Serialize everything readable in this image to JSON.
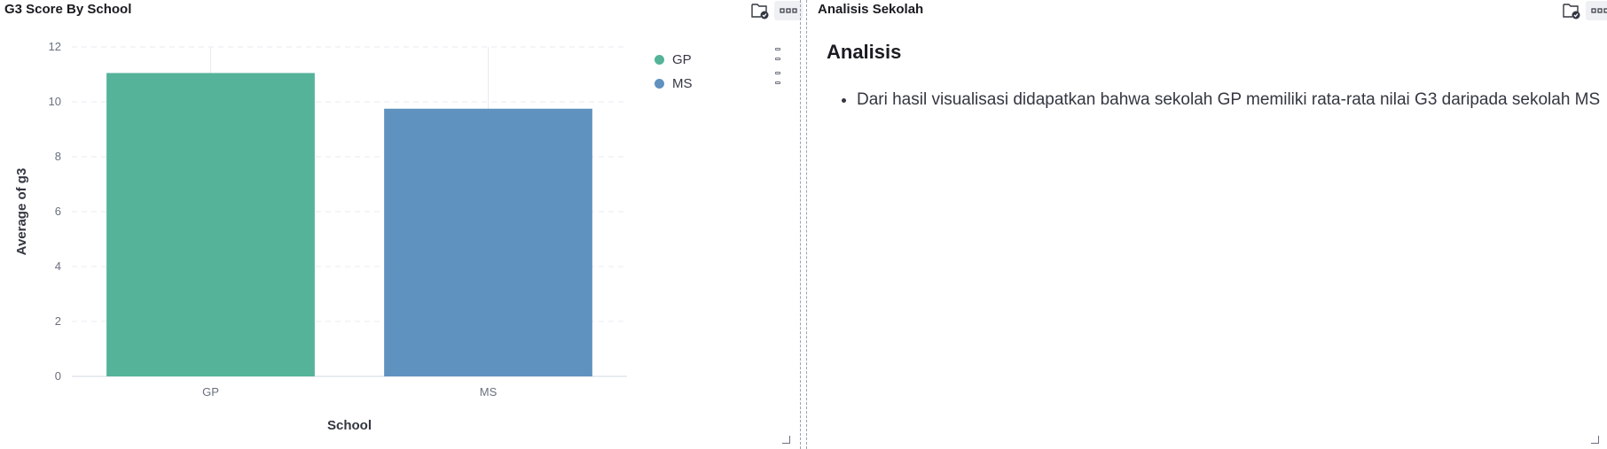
{
  "left_panel": {
    "title": "G3 Score By School",
    "icons": [
      "folder-check-icon",
      "options-icon"
    ]
  },
  "right_panel": {
    "title": "Analisis Sekolah",
    "icons": [
      "folder-check-icon",
      "options-icon"
    ],
    "markdown": {
      "heading": "Analisis",
      "bullets": [
        "Dari hasil visualisasi didapatkan bahwa sekolah GP memiliki rata-rata nilai G3 daripada sekolah MS"
      ]
    }
  },
  "colors": {
    "GP": "#54b399",
    "MS": "#6092c0",
    "grid": "#e9ebf0",
    "axis_text": "#69707d"
  },
  "chart_data": {
    "type": "bar",
    "title": "G3 Score By School",
    "categories": [
      "GP",
      "MS"
    ],
    "values": [
      11.05,
      9.75
    ],
    "xlabel": "School",
    "ylabel": "Average of g3",
    "ylim": [
      0,
      12
    ],
    "yticks": [
      "0",
      "2",
      "4",
      "6",
      "8",
      "10",
      "12"
    ],
    "grid": true,
    "legend": {
      "position": "right",
      "entries": [
        "GP",
        "MS"
      ]
    }
  }
}
